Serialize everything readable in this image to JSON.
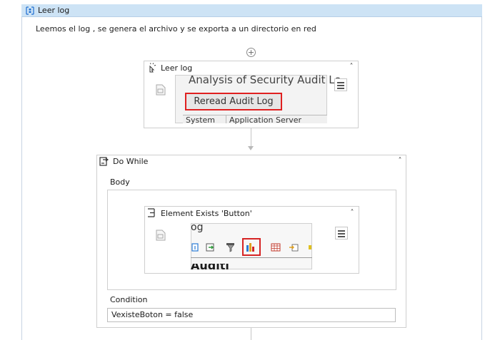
{
  "sequence": {
    "title": "Leer log",
    "description": "Leemos el log , se genera el archivo  y se exporta a un directorio en red"
  },
  "leer_log": {
    "title": "Leer log",
    "screenshot_title": "Analysis of Security Audit Lo",
    "button_label": "Reread Audit Log",
    "columns": [
      "System",
      "Application Server"
    ]
  },
  "do_while": {
    "title": "Do While",
    "body_label": "Body",
    "condition_label": "Condition",
    "condition_value": "VexisteBoton = false"
  },
  "element_exists": {
    "title": "Element Exists 'Button'",
    "screenshot_text": "og",
    "bold_text": "Auditl"
  },
  "icons": {
    "sequence": "sequence-icon",
    "add": "plus-circle-icon",
    "click": "click-icon",
    "collapse": "double-chevron-up-icon",
    "menu": "hamburger-icon",
    "do_while": "loop-icon",
    "element_exists": "element-exists-icon",
    "document": "document-icon"
  },
  "colors": {
    "header_bg": "#cde3f5",
    "highlight": "#e02020"
  }
}
